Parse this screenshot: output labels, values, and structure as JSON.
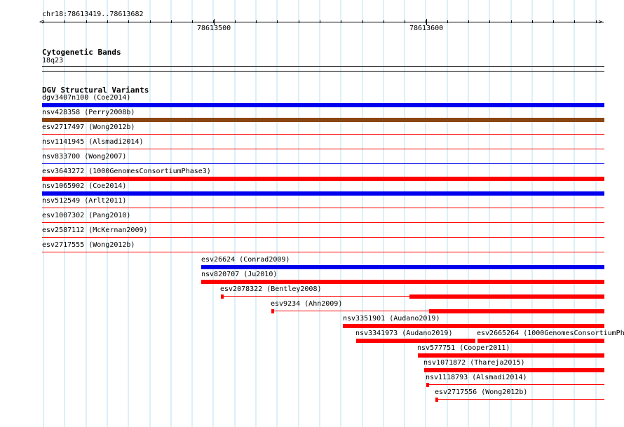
{
  "ruler": {
    "location": "chr18:78613419..78613682",
    "tick_labels": [
      "78613500",
      "78613600"
    ]
  },
  "cytoband": {
    "title": "Cytogenetic Bands",
    "band": "18q23"
  },
  "dgv": {
    "title": "DGV Structural Variants",
    "colors": {
      "blue": "#0000ee",
      "brown": "#8b4513",
      "red": "#ff0000"
    },
    "features": [
      {
        "label": "dgv3407n100 (Coe2014)",
        "color": "blue",
        "style": "thick"
      },
      {
        "label": "nsv428358 (Perry2008b)",
        "color": "brown",
        "style": "thick"
      },
      {
        "label": "esv2717497 (Wong2012b)",
        "color": "red",
        "style": "thin"
      },
      {
        "label": "nsv1141945 (Alsmadi2014)",
        "color": "red",
        "style": "thin"
      },
      {
        "label": "nsv833700 (Wong2007)",
        "color": "blue",
        "style": "thin"
      },
      {
        "label": "esv3643272 (1000GenomesConsortiumPhase3)",
        "color": "red",
        "style": "thick"
      },
      {
        "label": "nsv1065902 (Coe2014)",
        "color": "blue",
        "style": "thick"
      },
      {
        "label": "nsv512549 (Arlt2011)",
        "color": "red",
        "style": "thin"
      },
      {
        "label": "esv1007302 (Pang2010)",
        "color": "red",
        "style": "thin"
      },
      {
        "label": "esv2587112 (McKernan2009)",
        "color": "red",
        "style": "thin"
      },
      {
        "label": "esv2717555 (Wong2012b)",
        "color": "red",
        "style": "thin"
      },
      {
        "label": "esv26624 (Conrad2009)",
        "color": "blue",
        "style": "thick"
      },
      {
        "label": "nsv820707 (Ju2010)",
        "color": "red",
        "style": "thick"
      },
      {
        "label": "esv2078322 (Bentley2008)",
        "color": "red",
        "style": "split"
      },
      {
        "label": "esv9234 (Ahn2009)",
        "color": "red",
        "style": "split"
      },
      {
        "label": "nsv3351901 (Audano2019)",
        "color": "red",
        "style": "thick"
      },
      {
        "label": "nsv3341973 (Audano2019)",
        "color": "red",
        "style": "thick"
      },
      {
        "label": "esv2665264 (1000GenomesConsortiumPh",
        "color": "red",
        "style": "thick"
      },
      {
        "label": "nsv577751 (Cooper2011)",
        "color": "red",
        "style": "thick"
      },
      {
        "label": "nsv1071872 (Thareja2015)",
        "color": "red",
        "style": "thick"
      },
      {
        "label": "nsv1118793 (Alsmadi2014)",
        "color": "red",
        "style": "split"
      },
      {
        "label": "esv2717556 (Wong2012b)",
        "color": "red",
        "style": "split"
      }
    ]
  }
}
